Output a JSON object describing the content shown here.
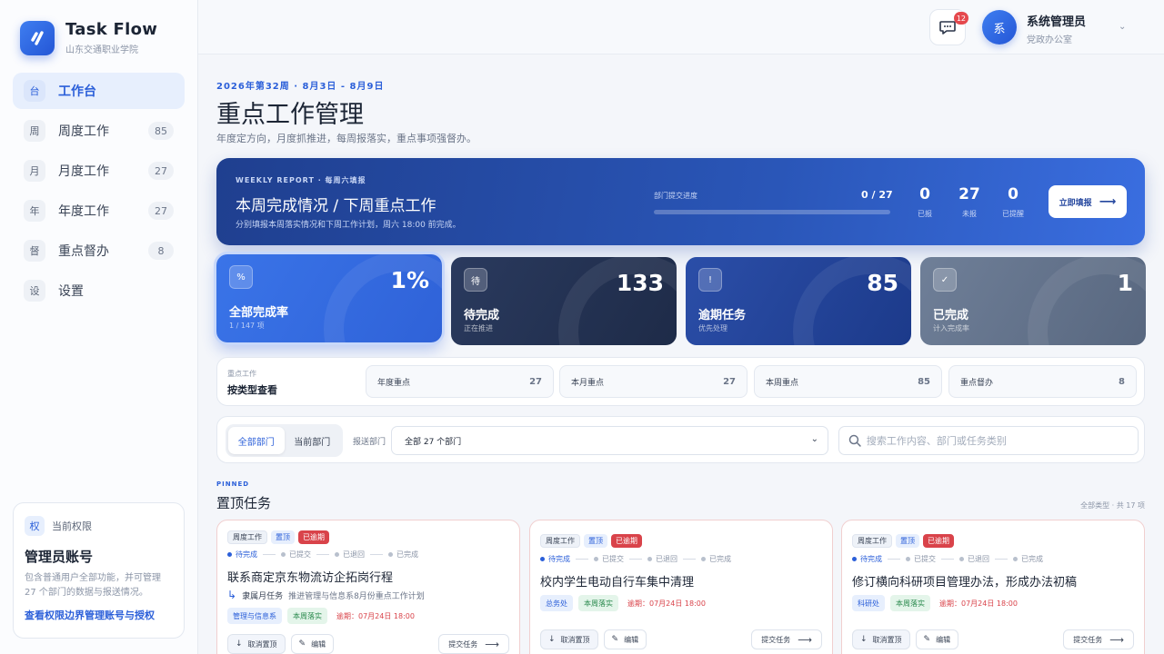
{
  "brand": {
    "title": "Task Flow",
    "subtitle": "山东交通职业学院",
    "logo_icon": "check-logo-icon"
  },
  "nav": [
    {
      "icon": "台",
      "label": "工作台",
      "count": "",
      "active": true
    },
    {
      "icon": "周",
      "label": "周度工作",
      "count": "85"
    },
    {
      "icon": "月",
      "label": "月度工作",
      "count": "27"
    },
    {
      "icon": "年",
      "label": "年度工作",
      "count": "27"
    },
    {
      "icon": "督",
      "label": "重点督办",
      "count": "8"
    },
    {
      "icon": "设",
      "label": "设置",
      "count": ""
    }
  ],
  "permission": {
    "icon": "权",
    "head": "当前权限",
    "title": "管理员账号",
    "desc": "包含普通用户全部功能，并可管理 27 个部门的数据与报送情况。",
    "link": "查看权限边界管理账号与授权"
  },
  "topbar": {
    "message_badge": "12",
    "avatar": "系",
    "user_name": "系统管理员",
    "user_dept": "党政办公室"
  },
  "header": {
    "week": "2026年第32周 · 8月3日 - 8月9日",
    "title": "重点工作管理",
    "subtitle": "年度定方向，月度抓推进，每周报落实，重点事项强督办。"
  },
  "banner": {
    "kicker": "WEEKLY REPORT · 每周六填报",
    "title": "本周完成情况 / 下周重点工作",
    "desc": "分别填报本周落实情况和下周工作计划，周六 18:00 前完成。",
    "progress_label": "部门提交进度",
    "progress_value": "0 / 27",
    "progress_fraction": 0,
    "stats": [
      {
        "num": "0",
        "label": "已报"
      },
      {
        "num": "27",
        "label": "未报"
      },
      {
        "num": "0",
        "label": "已提醒"
      }
    ],
    "button": "立即填报"
  },
  "kpis": [
    {
      "icon": "%",
      "num": "1%",
      "title": "全部完成率",
      "sub": "1 / 147 项"
    },
    {
      "icon": "待",
      "num": "133",
      "title": "待完成",
      "sub": "正在推进"
    },
    {
      "icon": "!",
      "num": "85",
      "title": "逾期任务",
      "sub": "优先处理"
    },
    {
      "icon": "✓",
      "num": "1",
      "title": "已完成",
      "sub": "计入完成率"
    }
  ],
  "types": {
    "kicker": "重点工作",
    "title": "按类型查看",
    "chips": [
      {
        "label": "年度重点",
        "count": "27"
      },
      {
        "label": "本月重点",
        "count": "27"
      },
      {
        "label": "本周重点",
        "count": "85"
      },
      {
        "label": "重点督办",
        "count": "8"
      }
    ]
  },
  "filter": {
    "seg": [
      "全部部门",
      "当前部门"
    ],
    "dept_label": "报送部门",
    "dept_value": "全部 27 个部门",
    "search_placeholder": "搜索工作内容、部门或任务类别"
  },
  "pinned": {
    "kicker": "PINNED",
    "title": "置顶任务",
    "meta": "全部类型 · 共 17 项",
    "steps": [
      "待完成",
      "已提交",
      "已退回",
      "已完成"
    ],
    "actions": {
      "unpin": "取消置顶",
      "edit": "编辑",
      "submit": "提交任务"
    },
    "tasks": [
      {
        "tags": [
          "周度工作",
          "置顶",
          "已逾期"
        ],
        "title": "联系商定京东物流访企拓岗行程",
        "parent_label": "隶属月任务",
        "parent_text": "推进管理与信息系8月份重点工作计划",
        "dept": "管理与信息系",
        "stage": "本周落实",
        "due": "逾期：07月24日 18:00"
      },
      {
        "tags": [
          "周度工作",
          "置顶",
          "已逾期"
        ],
        "title": "校内学生电动自行车集中清理",
        "dept": "总务处",
        "stage": "本周落实",
        "due": "逾期：07月24日 18:00"
      },
      {
        "tags": [
          "周度工作",
          "置顶",
          "已逾期"
        ],
        "title": "修订横向科研项目管理办法，形成办法初稿",
        "dept": "科研处",
        "stage": "本周落实",
        "due": "逾期：07月24日 18:00"
      }
    ]
  }
}
